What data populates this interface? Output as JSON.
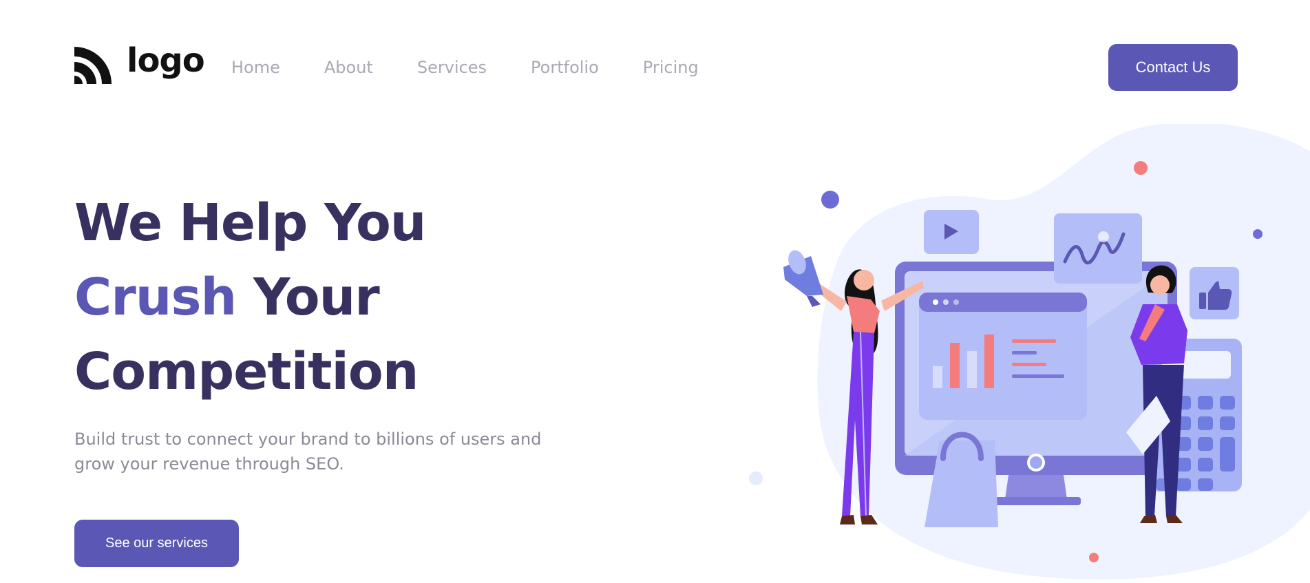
{
  "header": {
    "logo_text": "logo",
    "nav": [
      "Home",
      "About",
      "Services",
      "Portfolio",
      "Pricing"
    ],
    "contact_label": "Contact Us"
  },
  "hero": {
    "title_line1": "We Help You",
    "title_accent": "Crush",
    "title_line2_rest": " Your",
    "title_line3": "Competition",
    "subtitle": "Build trust to connect your brand to billions of users and grow your revenue through SEO.",
    "cta_label": "See our services"
  },
  "colors": {
    "primary": "#5b57b5",
    "heading": "#38305f",
    "nav_text": "#a9a9b3",
    "body_text": "#8a8a96",
    "blob": "#eef3ff",
    "coral": "#f47c7c"
  },
  "icons": [
    "logo-arcs-icon",
    "play-icon",
    "wave-chart-icon",
    "thumbs-up-icon",
    "megaphone-icon",
    "calculator-icon",
    "shopping-bag-icon"
  ]
}
